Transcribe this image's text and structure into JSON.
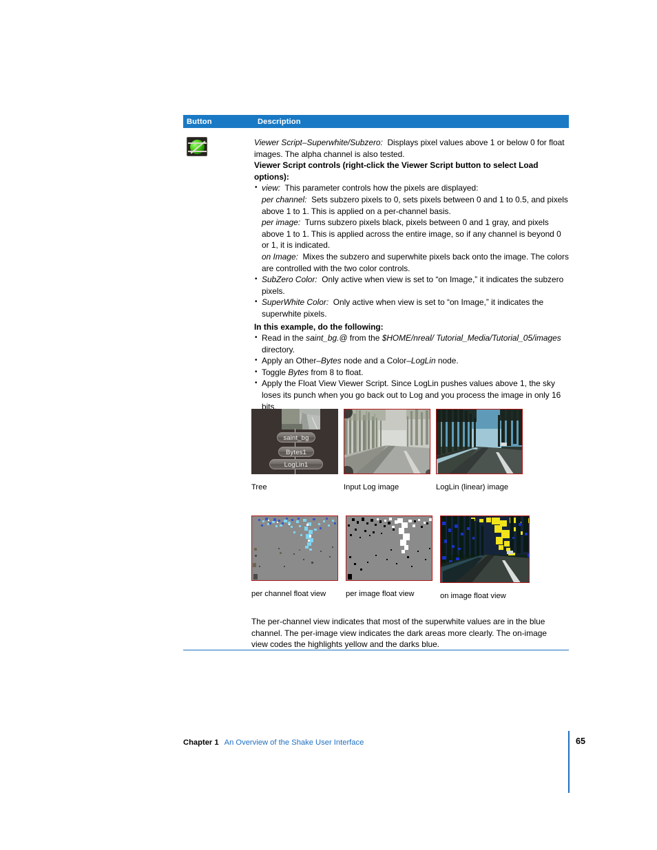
{
  "table": {
    "header": {
      "col_button": "Button",
      "col_description": "Description"
    },
    "button_icon": "viewer-script-superwhite-subzero-icon"
  },
  "description": {
    "intro_title": "Viewer Script–Superwhite/Subzero:",
    "intro_text": "Displays pixel values above 1 or below 0 for float images. The alpha channel is also tested.",
    "controls_heading": "Viewer Script controls (right-click the Viewer Script button to select Load options):",
    "bullets": [
      {
        "term": "view:",
        "text": "This parameter controls how the pixels are displayed:",
        "subitems": [
          {
            "term": "per channel:",
            "text": "Sets subzero pixels to 0, sets pixels between 0 and 1 to 0.5, and pixels above 1 to 1. This is applied on a per-channel basis."
          },
          {
            "term": "per image:",
            "text": "Turns subzero pixels black, pixels between 0 and 1 gray, and pixels above 1 to 1. This is applied across the entire image, so if any channel is beyond 0 or 1, it is indicated."
          },
          {
            "term": "on Image:",
            "text": "Mixes the subzero and superwhite pixels back onto the image. The colors are controlled with the two color controls."
          }
        ]
      },
      {
        "term": "SubZero Color:",
        "text": "Only active when view is set to “on Image,” it indicates the subzero pixels.",
        "subitems": []
      },
      {
        "term": "SuperWhite Color:",
        "text": "Only active when view is set to “on Image,” it indicates the superwhite pixels.",
        "subitems": []
      }
    ],
    "example_heading": "In this example, do the following:",
    "example_steps": [
      {
        "pre": "Read in the ",
        "em1": "saint_bg.@",
        "mid": " from the ",
        "em2": "$HOME/nreal/ Tutorial_Media/Tutorial_05/images",
        "post": " directory."
      },
      {
        "pre": "Apply an Other–",
        "em1": "Bytes",
        "mid": " node and a Color–",
        "em2": "LogLin",
        "post": " node."
      },
      {
        "pre": "Toggle ",
        "em1": "Bytes",
        "mid": " from 8 to float.",
        "em2": "",
        "post": ""
      },
      {
        "pre": "Apply the Float View Viewer Script. Since LogLin pushes values above 1, the sky loses its punch when you go back out to Log and you process the image in only 16 bits.",
        "em1": "",
        "mid": "",
        "em2": "",
        "post": ""
      }
    ],
    "closing": "The per-channel view indicates that most of the superwhite values are in the blue channel. The per-image view indicates the dark areas more clearly. The on-image view codes the highlights yellow and the darks blue."
  },
  "figures": {
    "row1": [
      {
        "caption": "Tree",
        "kind": "node-tree"
      },
      {
        "caption": "Input Log image",
        "kind": "log-photo"
      },
      {
        "caption": "LogLin (linear) image",
        "kind": "linear-photo"
      }
    ],
    "row2": [
      {
        "caption": "per channel float view",
        "kind": "per-channel"
      },
      {
        "caption": "per image float view",
        "kind": "per-image"
      },
      {
        "caption": "on image float view",
        "kind": "on-image"
      }
    ],
    "tree_nodes": [
      "saint_bg",
      "Bytes1",
      "LogLin1"
    ]
  },
  "footer": {
    "chapter": "Chapter 1",
    "chapter_title": "An Overview of the Shake User Interface",
    "page_number": "65"
  },
  "colors": {
    "header_blue": "#1a79c4",
    "link_blue": "#1f6fc0",
    "rule_blue": "#1f6fc0",
    "thumb_border_red": "#b41717",
    "tree_bg": "#3a3330"
  }
}
